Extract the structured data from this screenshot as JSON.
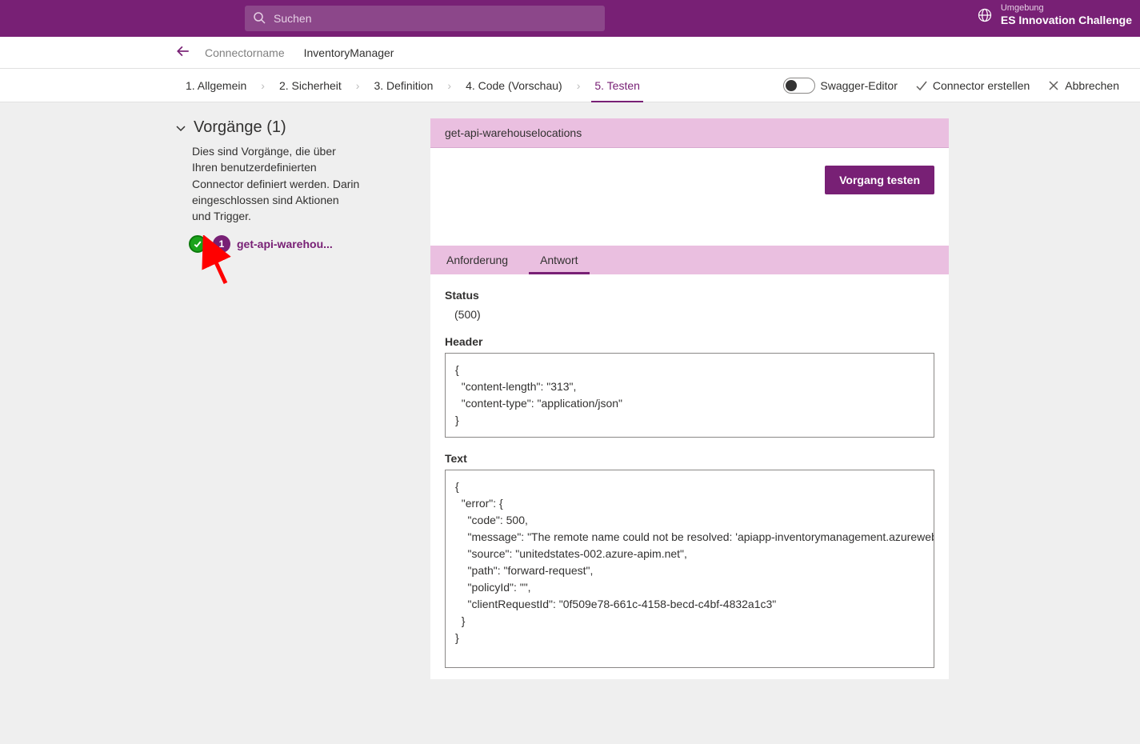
{
  "search_placeholder": "Suchen",
  "env_label": "Umgebung",
  "env_name": "ES Innovation Challenge",
  "breadcrumb_label": "Connectorname",
  "connector_name": "InventoryManager",
  "wizard": {
    "step1": "1. Allgemein",
    "step2": "2. Sicherheit",
    "step3": "3. Definition",
    "step4": "4. Code (Vorschau)",
    "step5": "5. Testen"
  },
  "toolbar": {
    "swagger": "Swagger-Editor",
    "create": "Connector erstellen",
    "cancel": "Abbrechen"
  },
  "operations": {
    "header": "Vorgänge (1)",
    "description": "Dies sind Vorgänge, die über Ihren benutzerdefinierten Connector definiert werden. Darin eingeschlossen sind Aktionen und Trigger.",
    "item_badge": "1",
    "item_name": "get-api-warehou..."
  },
  "op_title": "get-api-warehouselocations",
  "test_button": "Vorgang testen",
  "tabs": {
    "request": "Anforderung",
    "response": "Antwort"
  },
  "response": {
    "status_label": "Status",
    "status_value": "(500)",
    "header_label": "Header",
    "header_content": "{\n  \"content-length\": \"313\",\n  \"content-type\": \"application/json\"\n}",
    "text_label": "Text",
    "text_content": "{\n  \"error\": {\n    \"code\": 500,\n    \"message\": \"The remote name could not be resolved: 'apiapp-inventorymanagement.azurewebsite\n    \"source\": \"unitedstates-002.azure-apim.net\",\n    \"path\": \"forward-request\",\n    \"policyId\": \"\",\n    \"clientRequestId\": \"0f509e78-661c-4158-becd-c4bf-4832a1c3\"\n  }\n}"
  }
}
